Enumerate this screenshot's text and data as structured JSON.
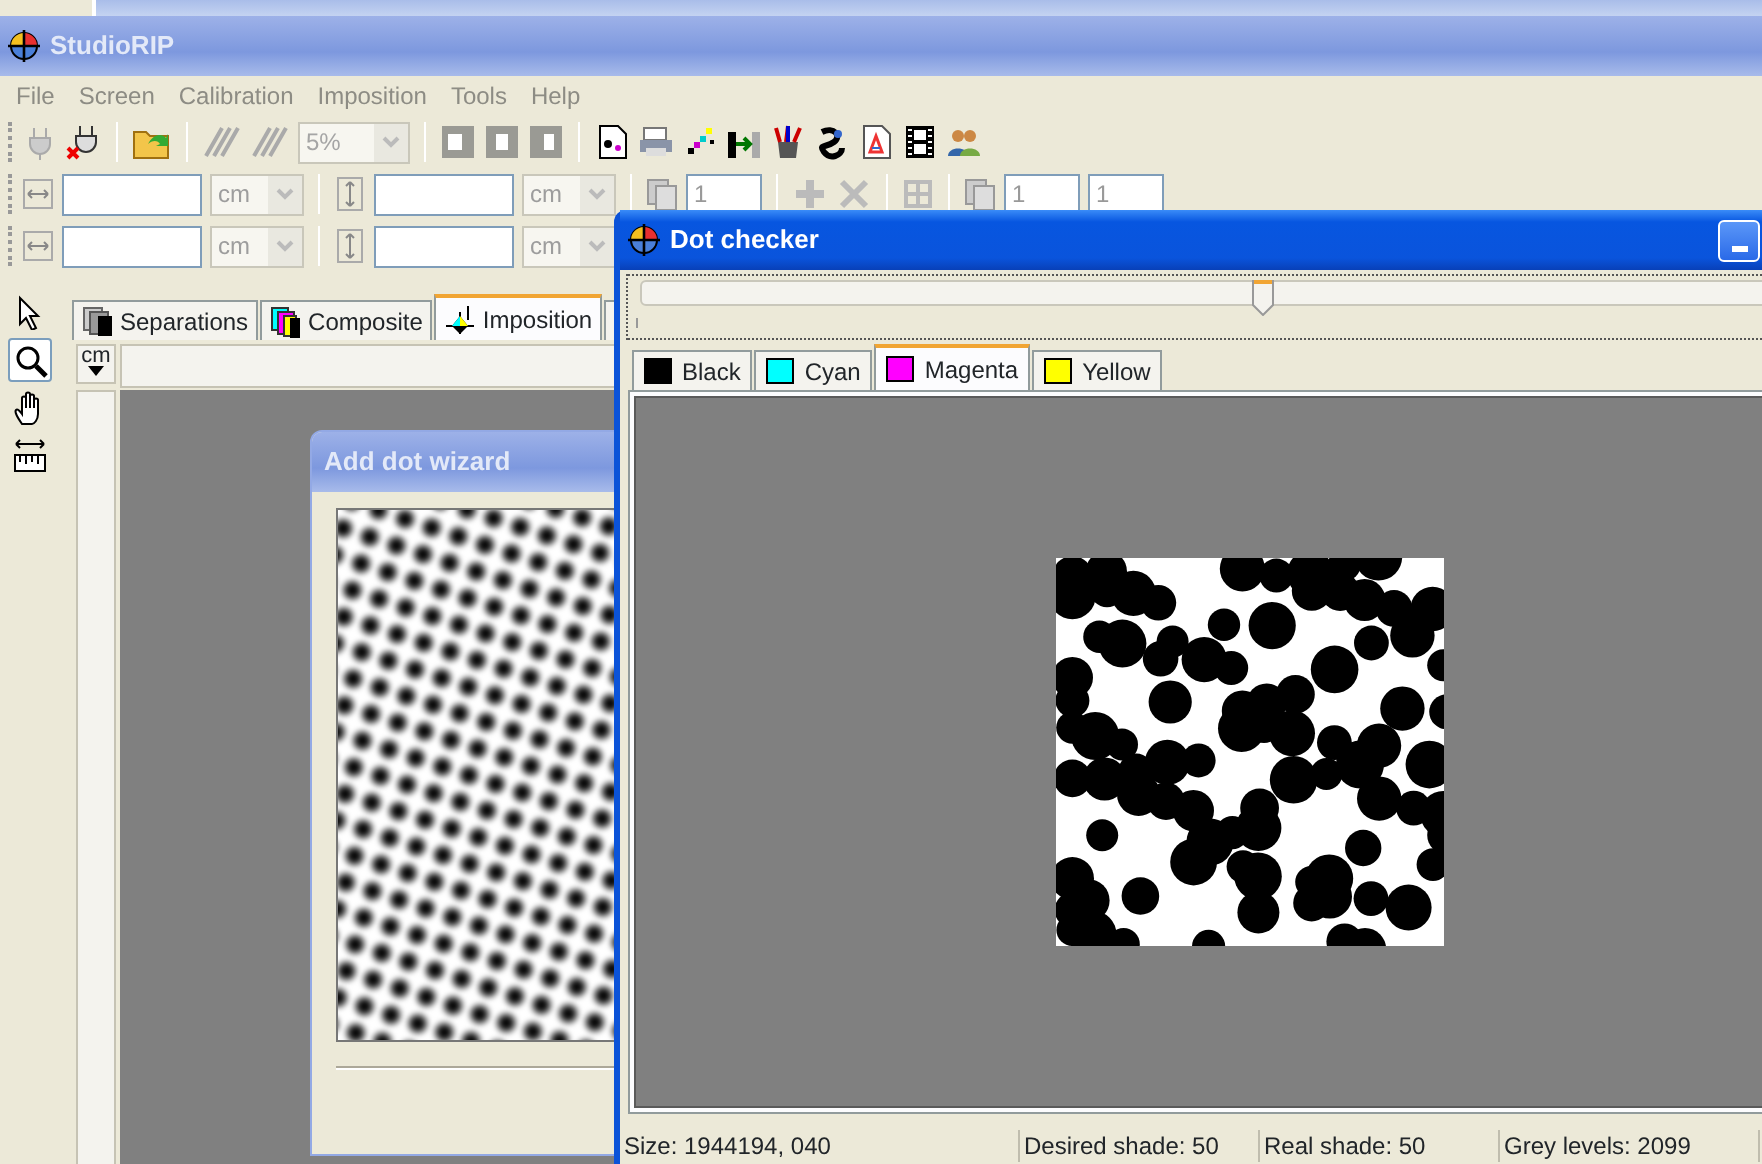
{
  "main_window": {
    "title": "StudioRIP",
    "menu": [
      "File",
      "Screen",
      "Calibration",
      "Imposition",
      "Tools",
      "Help"
    ],
    "zoom_combo": {
      "value": "5%",
      "disabled": true
    },
    "size_rows": [
      {
        "fields": [
          {
            "unit": "cm"
          },
          {
            "unit": "cm"
          }
        ]
      },
      {
        "fields": [
          {
            "unit": "cm"
          },
          {
            "unit": "cm"
          }
        ]
      }
    ],
    "copies_fields": [
      "1",
      "1",
      "1"
    ],
    "tools": [
      {
        "kind": "pointer",
        "selected": false
      },
      {
        "kind": "zoom",
        "selected": true
      },
      {
        "kind": "hand",
        "selected": false
      },
      {
        "kind": "measure",
        "selected": false
      }
    ],
    "tabs": [
      {
        "label": "Separations",
        "kind": "separations",
        "selected": false
      },
      {
        "label": "Composite",
        "kind": "composite",
        "selected": false
      },
      {
        "label": "Imposition",
        "kind": "imposition",
        "selected": true
      }
    ],
    "ruler_unit": "cm"
  },
  "wizard": {
    "title": "Add dot wizard"
  },
  "dot_checker": {
    "title": "Dot checker",
    "slider": {
      "level": 0.54
    },
    "tabs": [
      {
        "label": "Black",
        "color": "#000000",
        "selected": false
      },
      {
        "label": "Cyan",
        "color": "#00ffff",
        "selected": false
      },
      {
        "label": "Magenta",
        "color": "#ff00ff",
        "selected": true
      },
      {
        "label": "Yellow",
        "color": "#ffff00",
        "selected": false
      }
    ],
    "status": [
      "Size: 1944194, 040",
      "Desired shade: 50",
      "Real shade: 50",
      "Grey levels: 2099"
    ]
  }
}
